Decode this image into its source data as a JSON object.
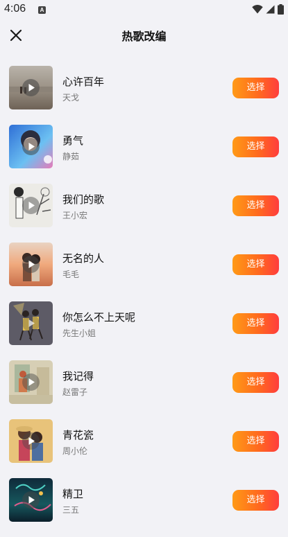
{
  "status_bar": {
    "time": "4:06",
    "notification_badge": "A"
  },
  "header": {
    "title": "热歌改编"
  },
  "songs": [
    {
      "title": "心许百年",
      "artist": "天戈",
      "action_label": "选择"
    },
    {
      "title": "勇气",
      "artist": "静茹",
      "action_label": "选择"
    },
    {
      "title": "我们的歌",
      "artist": "王小宏",
      "action_label": "选择"
    },
    {
      "title": "无名的人",
      "artist": "毛毛",
      "action_label": "选择"
    },
    {
      "title": "你怎么不上天呢",
      "artist": "先生小姐",
      "action_label": "选择"
    },
    {
      "title": "我记得",
      "artist": "赵雷子",
      "action_label": "选择"
    },
    {
      "title": "青花瓷",
      "artist": "周小伦",
      "action_label": "选择"
    },
    {
      "title": "精卫",
      "artist": "三五",
      "action_label": "选择"
    }
  ],
  "colors": {
    "button_gradient_start": "#ff9a17",
    "button_gradient_end": "#ff3d3d",
    "background": "#f2f2f6"
  }
}
